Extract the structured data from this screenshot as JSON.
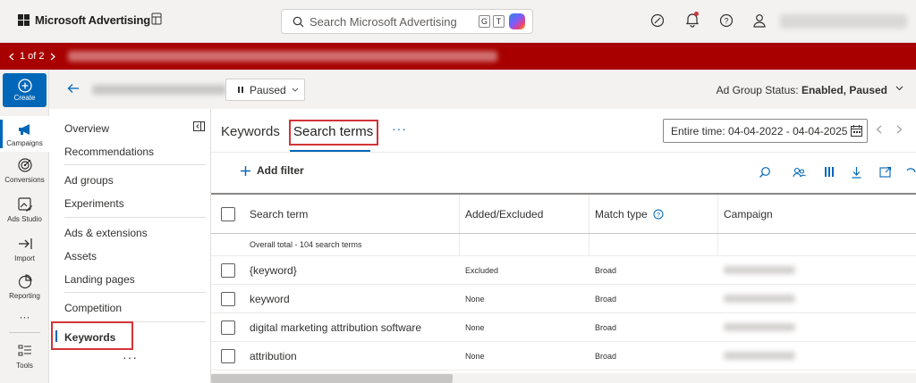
{
  "app": {
    "brand": "Microsoft Advertising",
    "search_placeholder": "Search Microsoft Advertising",
    "kbd1": "G",
    "kbd2": "T"
  },
  "alert_bar": {
    "pager": "1 of 2"
  },
  "rail": {
    "create": "Create",
    "items": [
      {
        "label": "Campaigns"
      },
      {
        "label": "Conversions"
      },
      {
        "label": "Ads Studio"
      },
      {
        "label": "Import"
      },
      {
        "label": "Reporting"
      },
      {
        "label": "Tools"
      }
    ],
    "more": "···"
  },
  "header": {
    "paused_label": "Paused",
    "status_prefix": "Ad Group Status:",
    "status_value": "Enabled, Paused"
  },
  "subnav": {
    "items": [
      "Overview",
      "Recommendations",
      "Ad groups",
      "Experiments",
      "Ads & extensions",
      "Assets",
      "Landing pages",
      "Competition",
      "Keywords"
    ],
    "more": "···"
  },
  "tabs": {
    "keywords": "Keywords",
    "search_terms": "Search terms",
    "more": "···"
  },
  "date_range": "Entire time: 04-04-2022 - 04-04-2025",
  "toolbar": {
    "add_filter": "Add filter"
  },
  "table": {
    "headers": {
      "search_term": "Search term",
      "added_excluded": "Added/Excluded",
      "match_type": "Match type",
      "campaign": "Campaign"
    },
    "total_label": "Overall total - 104 search terms",
    "rows": [
      {
        "term": "{keyword}",
        "added": "Excluded",
        "match": "Broad"
      },
      {
        "term": "keyword",
        "added": "None",
        "match": "Broad"
      },
      {
        "term": "digital marketing attribution software",
        "added": "None",
        "match": "Broad"
      },
      {
        "term": "attribution",
        "added": "None",
        "match": "Broad"
      }
    ]
  },
  "colors": {
    "accent": "#0067b8",
    "alert": "#a80000",
    "highlight_box": "#d13438"
  }
}
